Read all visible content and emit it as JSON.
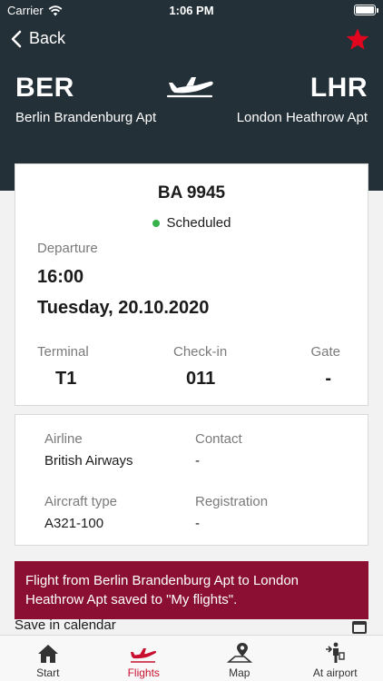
{
  "status_bar": {
    "carrier": "Carrier",
    "time": "1:06 PM"
  },
  "nav": {
    "back_label": "Back"
  },
  "route": {
    "from_code": "BER",
    "from_airport": "Berlin Brandenburg Apt",
    "to_code": "LHR",
    "to_airport": "London Heathrow Apt"
  },
  "flight": {
    "number": "BA 9945",
    "status": "Scheduled",
    "departure_label": "Departure",
    "departure_time": "16:00",
    "departure_date": "Tuesday, 20.10.2020",
    "terminal_label": "Terminal",
    "terminal": "T1",
    "checkin_label": "Check-in",
    "checkin": "011",
    "gate_label": "Gate",
    "gate": "-"
  },
  "details": {
    "airline_label": "Airline",
    "airline": "British Airways",
    "contact_label": "Contact",
    "contact": "-",
    "aircraft_label": "Aircraft type",
    "aircraft": "A321-100",
    "registration_label": "Registration",
    "registration": "-"
  },
  "calendar": {
    "label": "Save in calendar"
  },
  "toast": {
    "message": "Flight from Berlin Brandenburg Apt to London Heathrow Apt saved to \"My flights\"."
  },
  "tabs": [
    {
      "label": "Start",
      "icon": "home-icon"
    },
    {
      "label": "Flights",
      "icon": "plane-icon"
    },
    {
      "label": "Map",
      "icon": "map-pin-icon"
    },
    {
      "label": "At airport",
      "icon": "traveler-icon"
    }
  ],
  "colors": {
    "header": "#243038",
    "accent": "#c8102e",
    "toast": "#8b0f33",
    "status_ok": "#35b24b"
  }
}
